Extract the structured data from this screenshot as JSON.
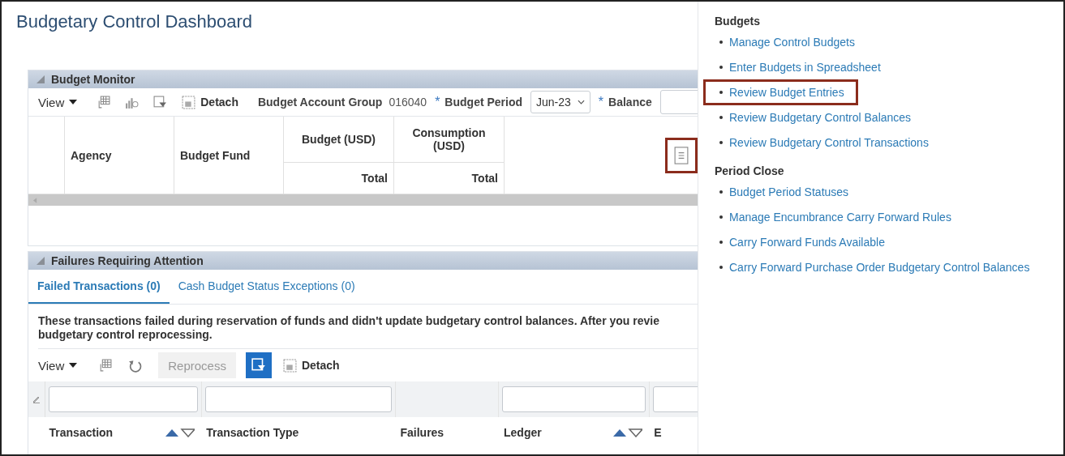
{
  "page_title": "Budgetary Control Dashboard",
  "budget_monitor": {
    "title": "Budget Monitor",
    "expanded": true,
    "toolbar": {
      "view": "View",
      "detach": "Detach"
    },
    "filters": [
      {
        "label": "Budget Account Group",
        "kind": "text",
        "value": "016040"
      },
      {
        "required_marker": "*",
        "label": "Budget Period",
        "kind": "select",
        "value": "Jun-23"
      },
      {
        "required_marker": "*",
        "label": "Balance",
        "kind": "select"
      }
    ],
    "columns": [
      {
        "label": "Agency"
      },
      {
        "label": "Budget Fund"
      },
      {
        "label": "Budget (USD)",
        "total": "Total"
      },
      {
        "label": "Consumption (USD)",
        "total": "Total"
      }
    ],
    "tasks_icon": {
      "highlighted": true
    }
  },
  "failures": {
    "title": "Failures Requiring Attention",
    "expanded": true,
    "tabs": [
      {
        "label": "Failed Transactions (0)",
        "selected": true
      },
      {
        "label": "Cash Budget Status Exceptions (0)",
        "selected": false
      }
    ],
    "message": "These transactions failed during reservation of funds and didn't update budgetary control balances. After you revie",
    "message_line2": "budgetary control reprocessing.",
    "toolbar": {
      "view": "View",
      "reprocess": {
        "label": "Reprocess",
        "disabled": true
      },
      "query_by_example": {
        "active": true
      },
      "detach": "Detach"
    },
    "columns": [
      {
        "label": "Transaction",
        "sortable": true,
        "filter": true
      },
      {
        "label": "Transaction Type",
        "sortable": false,
        "filter": true
      },
      {
        "label": "Failures",
        "sortable": false,
        "filter": false
      },
      {
        "label": "Ledger",
        "sortable": true,
        "filter": true
      },
      {
        "label": "E",
        "sortable": false,
        "filter": true
      }
    ]
  },
  "tasks": [
    {
      "title": "Budgets",
      "links": [
        {
          "label": "Manage Control Budgets",
          "highlighted": false
        },
        {
          "label": "Enter Budgets in Spreadsheet",
          "highlighted": false
        },
        {
          "label": "Review Budget Entries",
          "highlighted": true
        },
        {
          "label": "Review Budgetary Control Balances",
          "highlighted": false
        },
        {
          "label": "Review Budgetary Control Transactions",
          "highlighted": false
        }
      ]
    },
    {
      "title": "Period Close",
      "links": [
        {
          "label": "Budget Period Statuses",
          "highlighted": false
        },
        {
          "label": "Manage Encumbrance Carry Forward Rules",
          "highlighted": false
        },
        {
          "label": "Carry Forward Funds Available",
          "highlighted": false
        },
        {
          "label": "Carry Forward Purchase Order Budgetary Control Balances",
          "highlighted": false
        }
      ]
    }
  ]
}
